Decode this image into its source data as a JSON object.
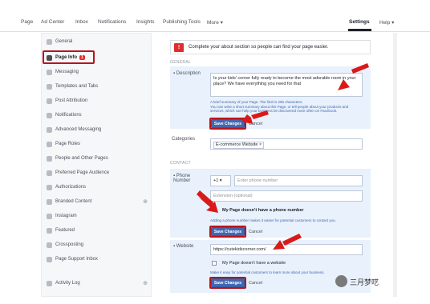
{
  "topbar": {
    "items": [
      "Page",
      "Ad Center",
      "Inbox",
      "Notifications",
      "Insights",
      "Publishing Tools",
      "More ▾"
    ],
    "settings": "Settings",
    "help": "Help ▾"
  },
  "sidebar": {
    "items": [
      {
        "label": "General"
      },
      {
        "label": "Page Info",
        "badge": "1"
      },
      {
        "label": "Messaging"
      },
      {
        "label": "Templates and Tabs"
      },
      {
        "label": "Post Attribution"
      },
      {
        "label": "Notifications"
      },
      {
        "label": "Advanced Messaging"
      },
      {
        "label": "Page Roles"
      },
      {
        "label": "People and Other Pages"
      },
      {
        "label": "Preferred Page Audience"
      },
      {
        "label": "Authorizations"
      },
      {
        "label": "Branded Content"
      },
      {
        "label": "Instagram"
      },
      {
        "label": "Featured"
      },
      {
        "label": "Crossposting"
      },
      {
        "label": "Page Support Inbox"
      },
      {
        "label": "Activity Log"
      }
    ]
  },
  "main": {
    "alert": "Complete your about section so people can find your page easier.",
    "general_heading": "GENERAL",
    "description_label": "Description",
    "description_value": "Is your kids' corner fully ready to become the most adorable room in your place? We have everything you need for that",
    "description_help": "A brief summary of your Page. The limit is 255 characters.\nYou can write a short summary about this Page, or tell people about your products and services, which can help your business be discovered more often on Facebook.",
    "save_label": "Save Changes",
    "cancel_label": "Cancel",
    "categories_label": "Categories",
    "category_tag": "E-commerce Website",
    "category_remove": "×",
    "contact_heading": "CONTACT",
    "phone_label": "Phone Number",
    "phone_code": "+1 ▾",
    "phone_placeholder": "Enter phone number",
    "extension_placeholder": "Extension (optional)",
    "no_phone_label": "My Page doesn't have a phone number",
    "phone_help": "Adding a phone number makes it easier for potential customers to contact you.",
    "website_label": "Website",
    "website_value": "https://cutekidscorner.com/",
    "no_website_label": "My Page doesn't have a website",
    "website_help": "Make it easy for potential customers to learn more about your business."
  },
  "watermark": "三月梦呓",
  "colors": {
    "highlight": "#b5161e",
    "button": "#4267b2",
    "panel": "#e8f1fc"
  }
}
